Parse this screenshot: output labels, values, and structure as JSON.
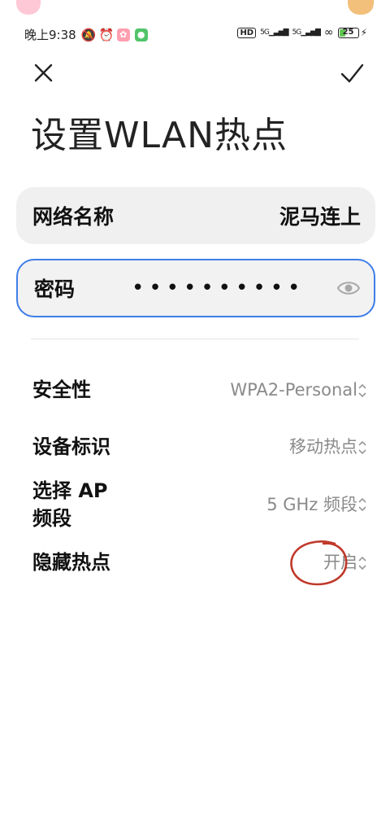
{
  "status_bar": {
    "time": "晚上9:38",
    "hd": "HD",
    "signal1": "5G",
    "signal2": "5G",
    "battery_level": "25"
  },
  "header": {
    "close_icon": "close-icon",
    "confirm_icon": "check-icon",
    "title": "设置WLAN热点"
  },
  "fields": {
    "network_name_label": "网络名称",
    "network_name_value": "泥马连上",
    "password_label": "密码",
    "password_value": "••••••••••"
  },
  "settings": {
    "security_label": "安全性",
    "security_value": "WPA2-Personal",
    "device_id_label": "设备标识",
    "device_id_value": "移动热点",
    "ap_band_label_line1": "选择 AP",
    "ap_band_label_line2": "频段",
    "ap_band_value": "5 GHz 频段",
    "hidden_label": "隐藏热点",
    "hidden_value": "开启"
  },
  "colors": {
    "focus_border": "#3f7ee8",
    "annotation_circle": "#c0392b",
    "battery_fill": "#62c653"
  }
}
